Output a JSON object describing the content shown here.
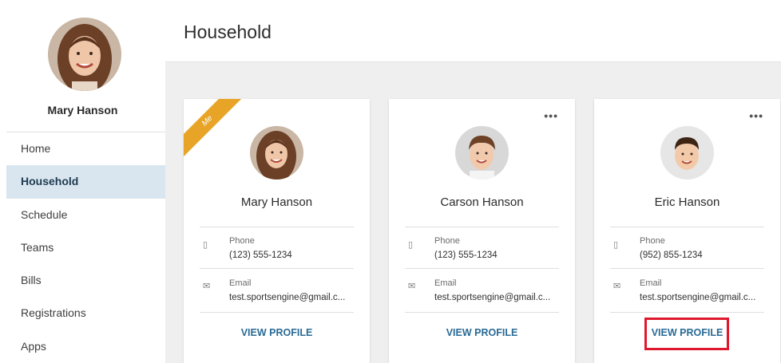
{
  "sidebar": {
    "user_name": "Mary Hanson",
    "items": [
      {
        "label": "Home"
      },
      {
        "label": "Household"
      },
      {
        "label": "Schedule"
      },
      {
        "label": "Teams"
      },
      {
        "label": "Bills"
      },
      {
        "label": "Registrations"
      },
      {
        "label": "Apps"
      }
    ],
    "active": "Household"
  },
  "header": {
    "title": "Household"
  },
  "cards": [
    {
      "name": "Mary Hanson",
      "ribbon": "Me",
      "phone_label": "Phone",
      "phone": "(123) 555-1234",
      "email_label": "Email",
      "email": "test.sportsengine@gmail.c...",
      "button": "VIEW PROFILE"
    },
    {
      "name": "Carson Hanson",
      "menu": "•••",
      "phone_label": "Phone",
      "phone": "(123) 555-1234",
      "email_label": "Email",
      "email": "test.sportsengine@gmail.c...",
      "button": "VIEW PROFILE"
    },
    {
      "name": "Eric Hanson",
      "menu": "•••",
      "phone_label": "Phone",
      "phone": "(952) 855-1234",
      "email_label": "Email",
      "email": "test.sportsengine@gmail.c...",
      "button": "VIEW PROFILE"
    }
  ],
  "colors": {
    "accent": "#2a6b96",
    "active_nav_bg": "#d9e6ef",
    "ribbon": "#e8a427",
    "highlight": "#e0182d",
    "page_bg": "#efefef"
  },
  "icons": {
    "phone": "phone-icon",
    "email": "envelope-icon",
    "menu": "more-options-icon"
  }
}
